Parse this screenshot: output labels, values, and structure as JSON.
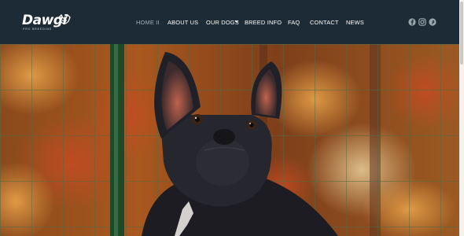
{
  "brand": {
    "name": "Dawgi",
    "tagline": "PRO BREEDING"
  },
  "nav": {
    "items": [
      {
        "label": "HOME II",
        "active": true
      },
      {
        "label": "ABOUT US"
      },
      {
        "label": "OUR DOGS",
        "has_dropdown": true
      },
      {
        "label": "BREED INFO"
      },
      {
        "label": "FAQ"
      },
      {
        "label": "CONTACT"
      },
      {
        "label": "NEWS"
      }
    ]
  },
  "social": [
    "facebook-icon",
    "instagram-icon",
    "pinterest-icon"
  ],
  "colors": {
    "header_bg": "#1d2b36",
    "nav_text": "#ffffff",
    "nav_active": "#9fb0bd",
    "social_icon": "#9aa6ae"
  },
  "hero": {
    "image": "black French bulldog sitting in front of a green wire fence with autumn foliage"
  }
}
